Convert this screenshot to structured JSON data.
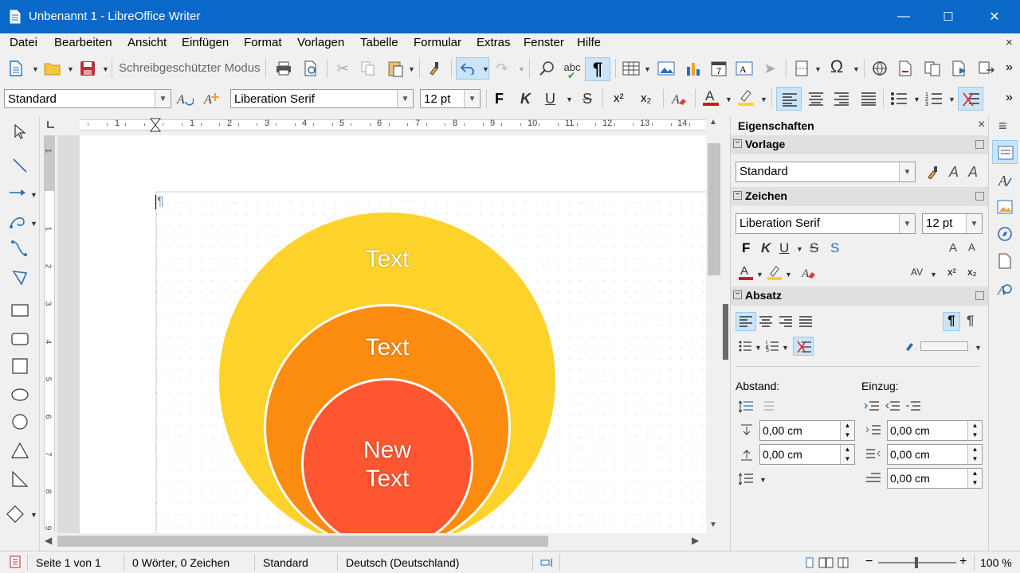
{
  "window": {
    "title": "Unbenannt 1 - LibreOffice Writer",
    "minimize": "—",
    "maximize": "☐",
    "close": "✕"
  },
  "menu": [
    "Datei",
    "Bearbeiten",
    "Ansicht",
    "Einfügen",
    "Format",
    "Vorlagen",
    "Tabelle",
    "Formular",
    "Extras",
    "Fenster",
    "Hilfe"
  ],
  "menu_close": "×",
  "toolbar1": {
    "readonly_label": "Schreibgeschützter Modus"
  },
  "toolbar2": {
    "para_style": "Standard",
    "font_name": "Liberation Serif",
    "font_size": "12 pt",
    "bold": "F",
    "italic": "K",
    "underline": "U",
    "strike": "S",
    "superscript": "x²",
    "subscript": "x₂"
  },
  "ruler": {
    "h_ticks": [
      "1",
      "1",
      "2",
      "3",
      "4",
      "5",
      "6",
      "7",
      "8",
      "9",
      "10",
      "11",
      "12",
      "13",
      "14"
    ],
    "v_ticks": [
      "1",
      "1",
      "2",
      "3",
      "4",
      "5",
      "6",
      "7",
      "8",
      "9"
    ]
  },
  "document": {
    "outer_text": "Text",
    "middle_text": "Text",
    "inner_text_1": "New",
    "inner_text_2": "Text",
    "pilcrow": "¶"
  },
  "diagram_colors": {
    "outer": "#fdd32b",
    "middle": "#fb8c0f",
    "inner": "#fd5630"
  },
  "sidebar": {
    "title": "Eigenschaften",
    "close": "×",
    "menu": "≡",
    "vorlage": {
      "header": "Vorlage",
      "style": "Standard"
    },
    "zeichen": {
      "header": "Zeichen",
      "font": "Liberation Serif",
      "size": "12 pt",
      "bold": "F",
      "italic": "K",
      "underline": "U",
      "strike": "S",
      "shadow": "S",
      "grow": "A",
      "shrink": "A",
      "superscript": "x²",
      "subscript": "x₂",
      "spacing": "AV"
    },
    "absatz": {
      "header": "Absatz",
      "abstand_label": "Abstand:",
      "einzug_label": "Einzug:",
      "above": "0,00 cm",
      "below": "0,00 cm",
      "before": "0,00 cm",
      "after": "0,00 cm",
      "first": "0,00 cm"
    }
  },
  "status": {
    "page": "Seite 1 von 1",
    "words": "0 Wörter, 0 Zeichen",
    "style": "Standard",
    "lang": "Deutsch (Deutschland)",
    "zoom": "100 %",
    "minus": "−",
    "plus": "+"
  }
}
